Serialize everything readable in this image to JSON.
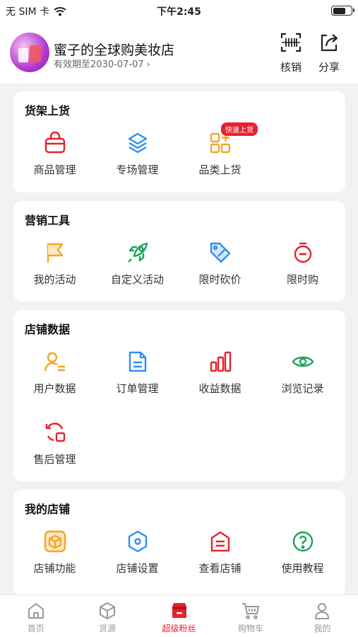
{
  "status_bar": {
    "carrier": "无 SIM 卡",
    "time": "下午2:45"
  },
  "header": {
    "store_name": "蜜子的全球购美妆店",
    "expire": "有效期至2030-07-07 ›",
    "verify_label": "核销",
    "share_label": "分享"
  },
  "sections": [
    {
      "title": "货架上货",
      "items": [
        {
          "label": "商品管理",
          "icon": "bag-icon"
        },
        {
          "label": "专场管理",
          "icon": "layers-icon"
        },
        {
          "label": "品类上货",
          "icon": "category-icon",
          "badge": "快速上货"
        }
      ]
    },
    {
      "title": "营销工具",
      "items": [
        {
          "label": "我的活动",
          "icon": "flag-icon"
        },
        {
          "label": "自定义活动",
          "icon": "rocket-icon"
        },
        {
          "label": "限时砍价",
          "icon": "price-tag-icon"
        },
        {
          "label": "限时购",
          "icon": "stopwatch-icon"
        }
      ]
    },
    {
      "title": "店铺数据",
      "items": [
        {
          "label": "用户数据",
          "icon": "user-list-icon"
        },
        {
          "label": "订单管理",
          "icon": "document-icon"
        },
        {
          "label": "收益数据",
          "icon": "bar-chart-icon"
        },
        {
          "label": "浏览记录",
          "icon": "eye-icon"
        },
        {
          "label": "售后管理",
          "icon": "refresh-box-icon"
        }
      ]
    },
    {
      "title": "我的店铺",
      "items": [
        {
          "label": "店铺功能",
          "icon": "cube-icon"
        },
        {
          "label": "店铺设置",
          "icon": "hexagon-settings-icon"
        },
        {
          "label": "查看店铺",
          "icon": "store-icon"
        },
        {
          "label": "使用教程",
          "icon": "help-icon"
        }
      ]
    }
  ],
  "tabbar": [
    {
      "label": "首页",
      "icon": "home-icon"
    },
    {
      "label": "货源",
      "icon": "box-icon"
    },
    {
      "label": "超级粉丝",
      "icon": "shop-icon",
      "active": true
    },
    {
      "label": "购物车",
      "icon": "cart-icon"
    },
    {
      "label": "我的",
      "icon": "person-icon"
    }
  ],
  "colors": {
    "accent": "#e8202f",
    "orange": "#f5a623",
    "blue": "#2f8ff0",
    "green": "#1aa35a"
  }
}
